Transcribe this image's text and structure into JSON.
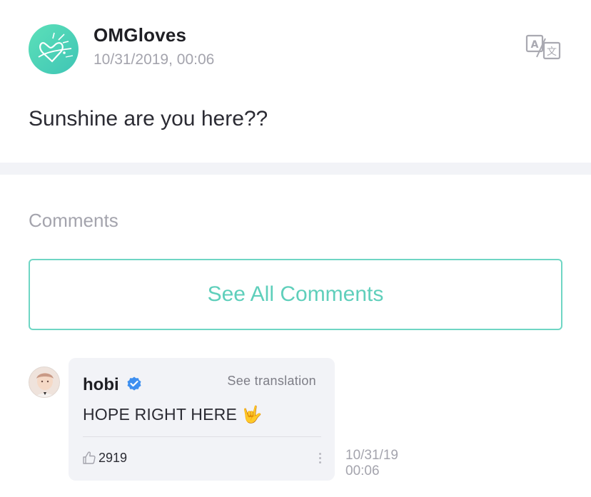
{
  "post": {
    "author": "OMGloves",
    "date": "10/31/2019, 00:06",
    "body": "Sunshine are you here??",
    "avatar_icon": "heart-doodle-avatar",
    "translate_icon": "translate-icon"
  },
  "comments_section": {
    "title": "Comments",
    "see_all_label": "See All Comments"
  },
  "comment": {
    "author": "hobi",
    "verified": true,
    "see_translation_label": "See translation",
    "text": "HOPE RIGHT HERE",
    "emoji": "🤟",
    "likes": "2919",
    "date_line1": "10/31/19",
    "date_line2": "00:06"
  },
  "colors": {
    "accent": "#5fcfbb",
    "avatar_gradient_start": "#5ce0b8",
    "avatar_gradient_end": "#3fc5b6",
    "verified_blue": "#3d8ff0",
    "divider_band": "#f2f3f7"
  }
}
